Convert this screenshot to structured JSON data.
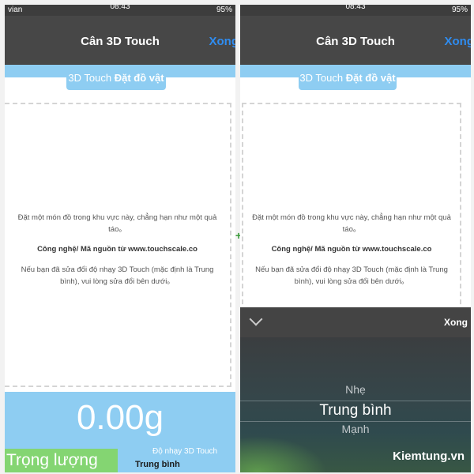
{
  "status": {
    "time": "08:43",
    "battery": "95%",
    "carrier": "vian"
  },
  "left": {
    "nav": {
      "title": "Cân 3D Touch",
      "done": "Xong"
    },
    "label_prefix": "3D Touch ",
    "label_bold": "Đặt đồ vật",
    "info_1": "Đặt một món đồ trong khu vực này, chẳng hạn như một quả táo。",
    "info_2": "Công nghệ/ Mã nguồn từ www.touchscale.co",
    "info_3": "Nếu bạn đã sửa đổi độ nhạy 3D Touch (mặc định là Trung bình), vui lòng sửa đổi bên dưới。",
    "weight": "0.00g",
    "weight_button": "Trọng lượng",
    "sensitivity_label": "Độ nhạy 3D Touch",
    "sensitivity_value": "Trung bình"
  },
  "right": {
    "nav": {
      "title": "Cân 3D Touch",
      "done": "Xong"
    },
    "label_prefix": "3D Touch ",
    "label_bold": "Đặt đồ vật",
    "info_1": "Đặt một món đồ trong khu vực này, chẳng hạn như một quả táo。",
    "info_2": "Công nghệ/ Mã nguồn từ www.touchscale.co",
    "info_3": "Nếu bạn đã sửa đổi độ nhạy 3D Touch (mặc định là Trung bình), vui lòng sửa đổi bên dưới。",
    "picker_done": "Xong",
    "options": [
      "Nhẹ",
      "Trung bình",
      "Mạnh"
    ]
  },
  "watermark": "Kiemtung.vn",
  "colors": {
    "accent_blue": "#8ecdf2",
    "done_blue": "#2f8cf0",
    "green": "#84d572",
    "nav": "#474747"
  }
}
